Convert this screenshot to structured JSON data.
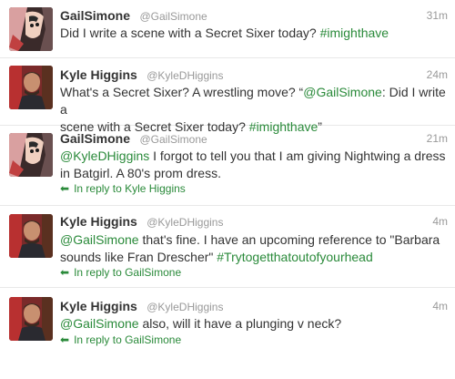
{
  "tweets": [
    {
      "name": "GailSimone",
      "handle": "@GailSimone",
      "time": "31m",
      "avatar": "comic-art-avatar",
      "text_parts": [
        "Did I write a scene with a Secret Sixer today? ",
        "#imighthave"
      ]
    },
    {
      "name": "Kyle Higgins",
      "handle": "@KyleDHiggins",
      "time": "24m",
      "avatar": "photo-avatar",
      "text_parts": [
        "What's a Secret Sixer? A wrestling move? “",
        "@GailSimone",
        ": Did I write a",
        "scene with a Secret Sixer today? ",
        "#imighthave",
        "”"
      ]
    },
    {
      "name": "GailSimone",
      "handle": "@GailSimone",
      "time": "21m",
      "avatar": "comic-art-avatar",
      "text_parts": [
        "@KyleDHiggins",
        " I forgot to tell you that I am giving Nightwing a dress",
        "in Batgirl. A 80's prom dress."
      ],
      "reply": "In reply to Kyle Higgins"
    },
    {
      "name": "Kyle Higgins",
      "handle": "@KyleDHiggins",
      "time": "4m",
      "avatar": "photo-avatar",
      "text_parts": [
        "@GailSimone",
        " that's fine. I have an upcoming reference to \"Barbara",
        "sounds like Fran Drescher\" ",
        "#Trytogetthatoutofyourhead"
      ],
      "reply": "In reply to GailSimone"
    },
    {
      "name": "Kyle Higgins",
      "handle": "@KyleDHiggins",
      "time": "4m",
      "avatar": "photo-avatar",
      "text_parts": [
        "@GailSimone",
        " also, will it have a plunging v neck?"
      ],
      "reply": "In reply to GailSimone"
    }
  ],
  "colors": {
    "link": "#2a8a3a",
    "meta": "#999999",
    "text": "#333333"
  },
  "icons": {
    "reply": "reply-arrow-icon"
  }
}
